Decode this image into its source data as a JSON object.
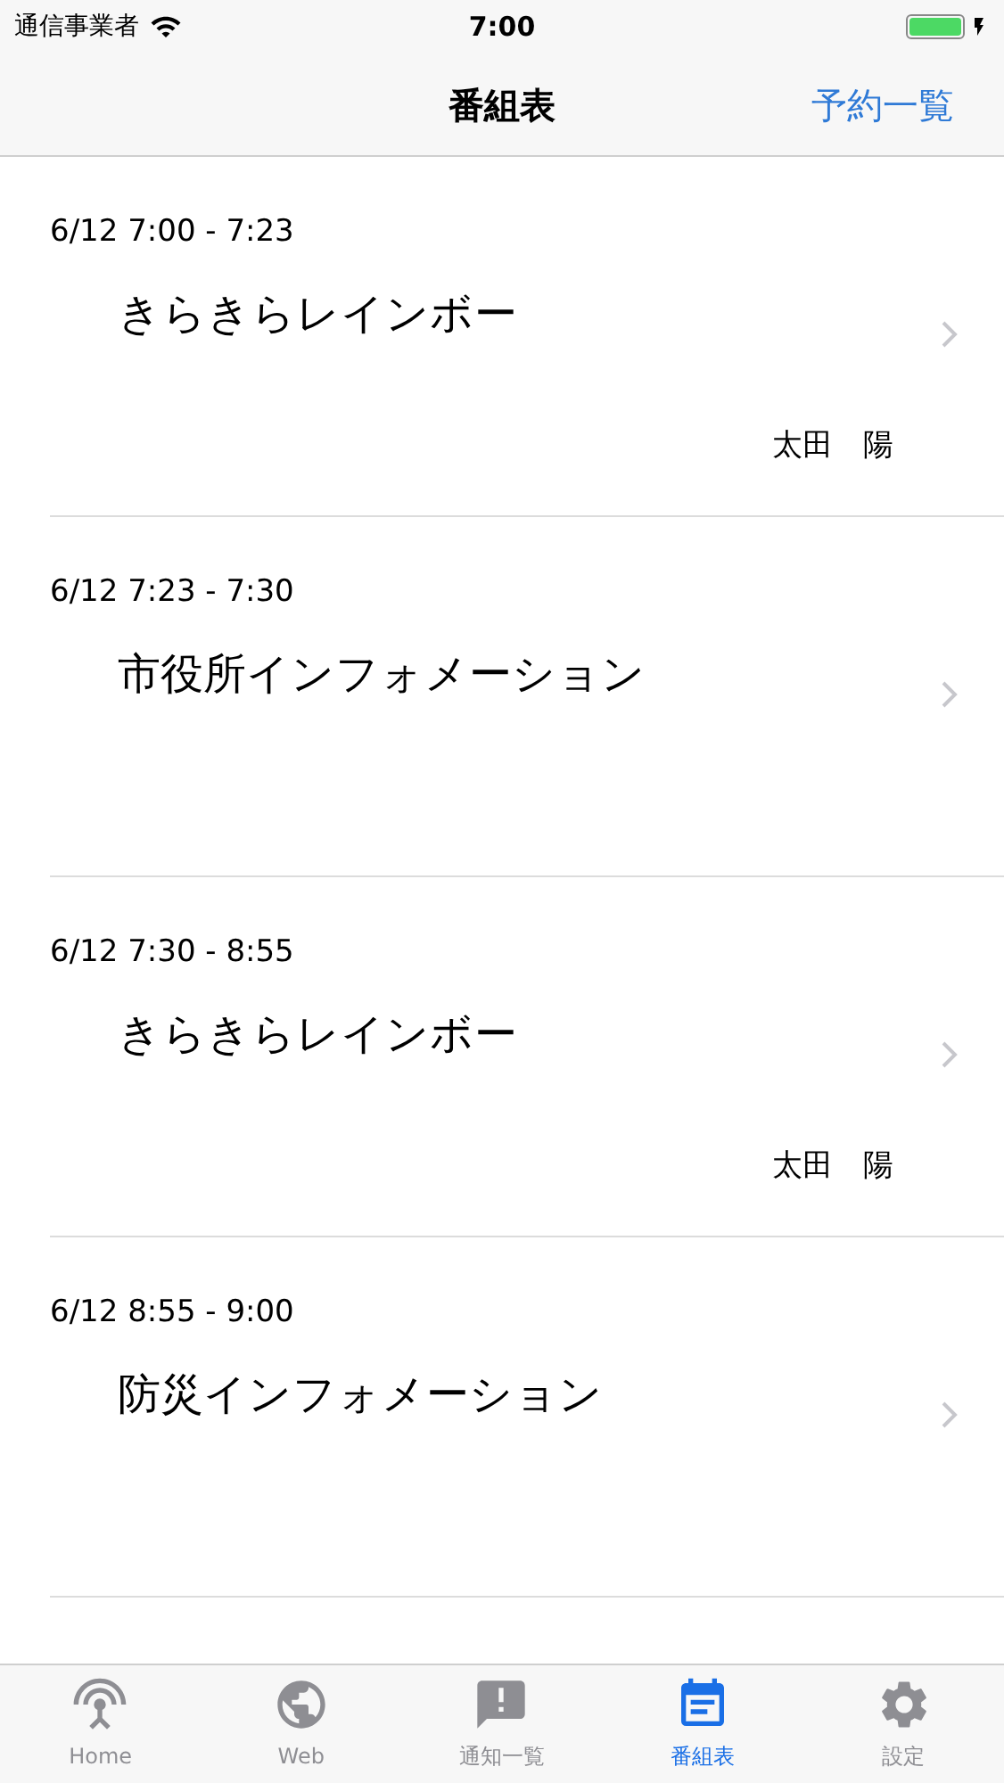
{
  "status_bar": {
    "carrier": "通信事業者",
    "time": "7:00"
  },
  "nav": {
    "title": "番組表",
    "action": "予約一覧"
  },
  "programs": [
    {
      "time": "6/12 7:00 - 7:23",
      "title": "きらきらレインボー",
      "presenter": "太田　陽"
    },
    {
      "time": "6/12 7:23 - 7:30",
      "title": "市役所インフォメーション"
    },
    {
      "time": "6/12 7:30 - 8:55",
      "title": "きらきらレインボー",
      "presenter": "太田　陽"
    },
    {
      "time": "6/12 8:55 - 9:00",
      "title": "防災インフォメーション"
    }
  ],
  "tab_bar": [
    {
      "kind": "antenna",
      "label": "Home",
      "selected": false
    },
    {
      "kind": "globe",
      "label": "Web",
      "selected": false
    },
    {
      "kind": "alert",
      "label": "通知一覧",
      "selected": false
    },
    {
      "kind": "calendar",
      "label": "番組表",
      "selected": true
    },
    {
      "kind": "settings",
      "label": "設定",
      "selected": false
    }
  ]
}
